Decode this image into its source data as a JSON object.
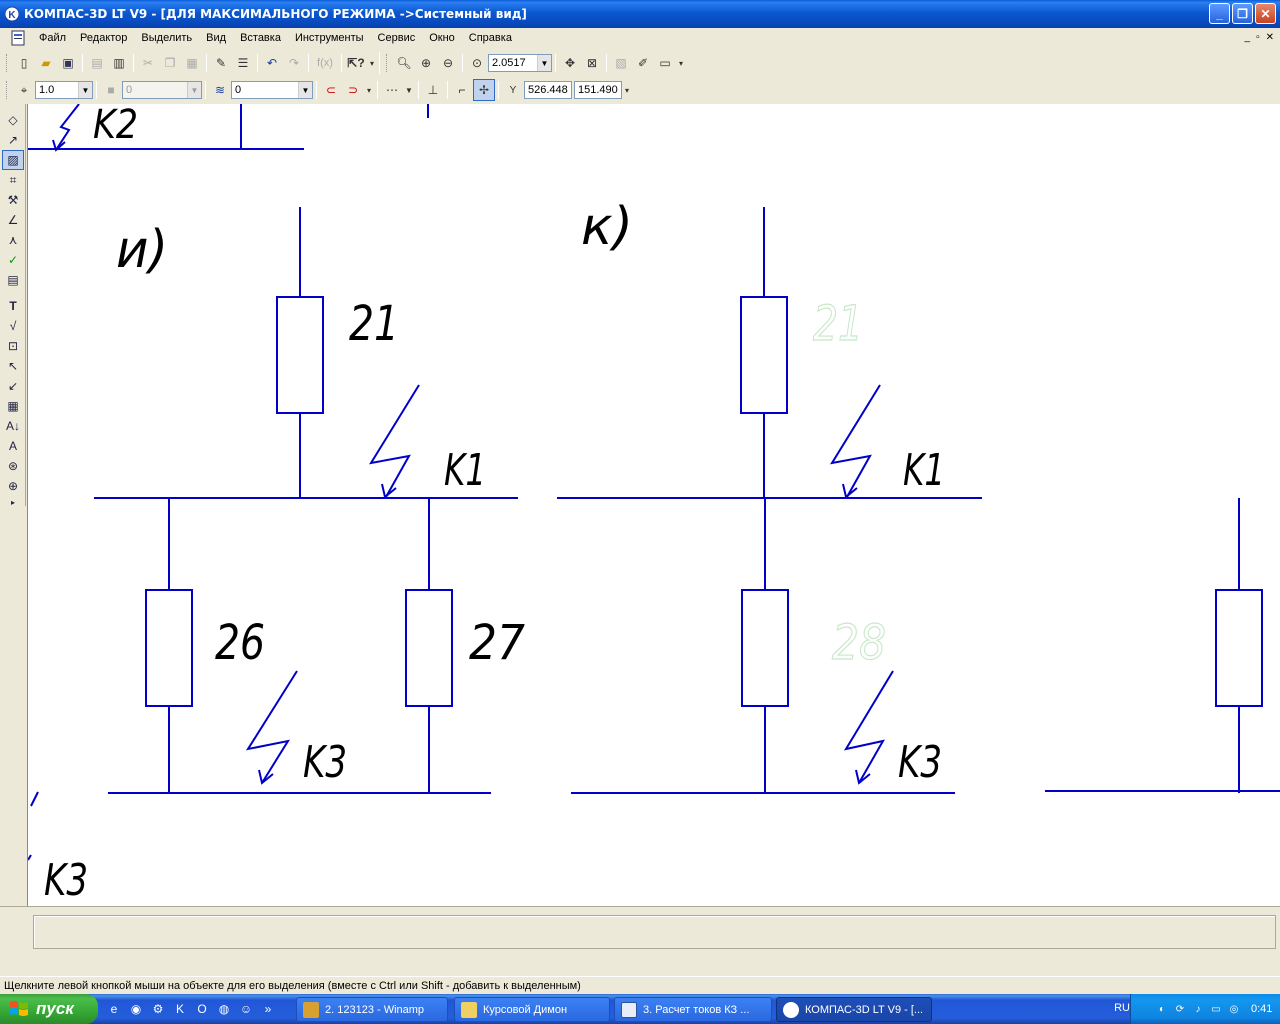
{
  "window": {
    "title": "КОМПАС-3D LT V9 - [ДЛЯ МАКСИМАЛЬНОГО РЕЖИМА ->Системный вид]",
    "controls": [
      "_",
      "❐",
      "✕"
    ]
  },
  "menu": {
    "items": [
      "Файл",
      "Редактор",
      "Выделить",
      "Вид",
      "Вставка",
      "Инструменты",
      "Сервис",
      "Окно",
      "Справка"
    ],
    "mdi_controls": [
      "_",
      "▫",
      "✕"
    ]
  },
  "toolbar": {
    "zoom_value": "2.0517",
    "fx_label": "f(x)"
  },
  "toolbar2": {
    "step_value": "1.0",
    "layer_value": "0",
    "state_value": "0",
    "coord_label": "Y",
    "coord_x": "526.448",
    "coord_y": "151.490"
  },
  "drawing": {
    "label_i": "и)",
    "label_k": "к)",
    "label_k2": "K2",
    "label_k1_left": "K1",
    "label_k1_right": "K1",
    "label_k3_left": "K3",
    "label_k3_right": "K3",
    "label_k3_bottom": "K3",
    "num_21_left": "21",
    "num_21_right": "21",
    "num_26": "26",
    "num_27": "27",
    "num_28": "28",
    "line_color": "#0000c8"
  },
  "status": {
    "text": "Щелкните левой кнопкой мыши на объекте для его выделения (вместе с Ctrl или Shift - добавить к выделенным)"
  },
  "taskbar": {
    "start_label": "пуск",
    "chevron": "»",
    "tasks": [
      {
        "label": "2. 123123 - Winamp"
      },
      {
        "label": "Курсовой Димон"
      },
      {
        "label": "3. Расчет токов КЗ ..."
      },
      {
        "label": "КОМПАС-3D LT V9 - [..."
      }
    ],
    "lang": "RU",
    "clock": "0:41"
  }
}
